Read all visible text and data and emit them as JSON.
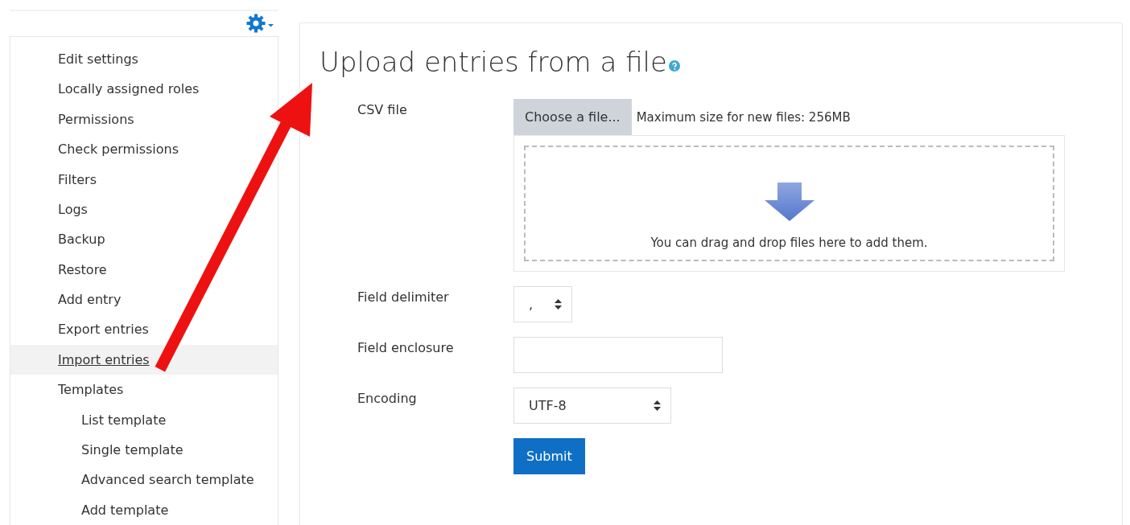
{
  "menu": {
    "items": [
      {
        "label": "Edit settings",
        "hovered": false
      },
      {
        "label": "Locally assigned roles",
        "hovered": false
      },
      {
        "label": "Permissions",
        "hovered": false
      },
      {
        "label": "Check permissions",
        "hovered": false
      },
      {
        "label": "Filters",
        "hovered": false
      },
      {
        "label": "Logs",
        "hovered": false
      },
      {
        "label": "Backup",
        "hovered": false
      },
      {
        "label": "Restore",
        "hovered": false
      },
      {
        "label": "Add entry",
        "hovered": false
      },
      {
        "label": "Export entries",
        "hovered": false
      },
      {
        "label": "Import entries",
        "hovered": true
      },
      {
        "label": "Templates",
        "hovered": false,
        "children": [
          {
            "label": "List template",
            "hovered": false
          },
          {
            "label": "Single template",
            "hovered": false
          },
          {
            "label": "Advanced search template",
            "hovered": false
          },
          {
            "label": "Add template",
            "hovered": false
          }
        ]
      }
    ]
  },
  "form": {
    "title": "Upload entries from a file",
    "csv_file": {
      "label": "CSV file",
      "button": "Choose a file...",
      "max_size": "Maximum size for new files: 256MB",
      "drop_hint": "You can drag and drop files here to add them."
    },
    "field_delimiter": {
      "label": "Field delimiter",
      "value": ","
    },
    "field_enclosure": {
      "label": "Field enclosure"
    },
    "encoding": {
      "label": "Encoding",
      "value": "UTF-8"
    },
    "submit": "Submit"
  }
}
